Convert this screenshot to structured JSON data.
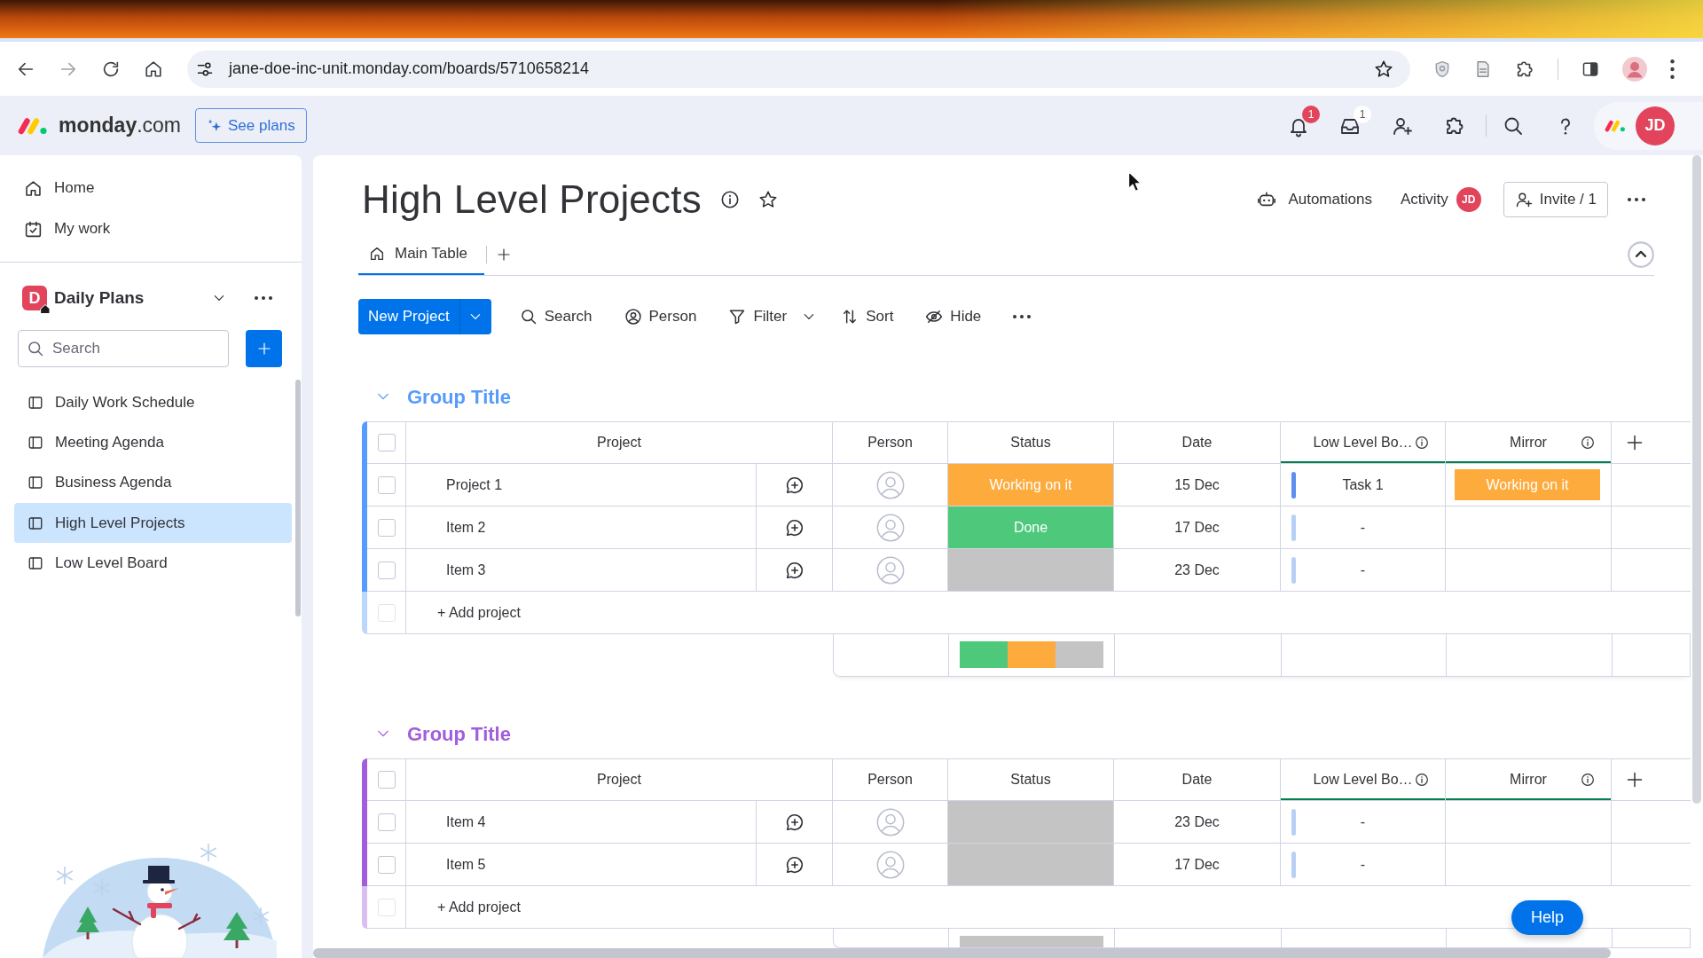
{
  "browser": {
    "url": "jane-doe-inc-unit.monday.com/boards/5710658214"
  },
  "app_header": {
    "logo": "**monday**.com",
    "see_plans": "See plans",
    "notifications": {
      "count": "1"
    },
    "inbox": {
      "count": "1"
    },
    "avatar": "JD"
  },
  "sidebar": {
    "nav": [
      {
        "label": "Home",
        "kind": "home"
      },
      {
        "label": "My work",
        "kind": "my_work"
      }
    ],
    "workspace": {
      "initial": "D",
      "name": "Daily Plans"
    },
    "search": {
      "placeholder": "Search"
    },
    "boards": [
      {
        "label": "Daily Work Schedule",
        "selected": false
      },
      {
        "label": "Meeting Agenda",
        "selected": false
      },
      {
        "label": "Business Agenda",
        "selected": false
      },
      {
        "label": "High Level Projects",
        "selected": true
      },
      {
        "label": "Low Level Board",
        "selected": false
      }
    ]
  },
  "board": {
    "title": "High Level Projects",
    "automations": "Automations",
    "activity": {
      "label": "Activity",
      "avatar": "JD"
    },
    "invite": "Invite / 1",
    "tabs": [
      {
        "label": "Main Table",
        "selected": true
      }
    ],
    "toolbar": {
      "primary": "New Project",
      "tools": [
        {
          "label": "Search",
          "kind": "search"
        },
        {
          "label": "Person",
          "kind": "person"
        },
        {
          "label": "Filter",
          "kind": "filter"
        },
        {
          "label": "Sort",
          "kind": "sort"
        },
        {
          "label": "Hide",
          "kind": "hide"
        }
      ]
    },
    "groups": [
      {
        "title": "Group Title",
        "color": "#579bfc",
        "select_all": {
          "checked": false
        },
        "columns": [
          {
            "label": "Project",
            "kind": "name"
          },
          {
            "label": "Person",
            "kind": "people"
          },
          {
            "label": "Status",
            "kind": "status"
          },
          {
            "label": "Date",
            "kind": "date"
          },
          {
            "label": "Low Level Bo…",
            "kind": "connect"
          },
          {
            "label": "Mirror",
            "kind": "mirror"
          }
        ],
        "rows": [
          {
            "name": "Project 1",
            "checked": false,
            "status": {
              "label": "Working on it",
              "color": "#fdab3d"
            },
            "date": "15 Dec",
            "link": {
              "label": "Task 1",
              "linked": true
            },
            "mirror": {
              "label": "Working on it",
              "color": "#fdab3d"
            }
          },
          {
            "name": "Item 2",
            "checked": false,
            "status": {
              "label": "Done",
              "color": "#4ec97b"
            },
            "date": "17 Dec",
            "link": {
              "label": "-",
              "linked": false
            }
          },
          {
            "name": "Item 3",
            "checked": false,
            "status": {
              "color": "#c4c4c4"
            },
            "date": "23 Dec",
            "link": {
              "label": "-",
              "linked": false
            }
          }
        ],
        "add_item": {
          "placeholder": "+ Add project",
          "checkbox": {
            "checked": false,
            "disabled": true
          }
        },
        "summary": [
          {
            "color": "#4ec97b"
          },
          {
            "color": "#fdab3d"
          },
          {
            "color": "#c4c4c4"
          }
        ]
      },
      {
        "title": "Group Title",
        "color": "#a25ddc",
        "select_all": {
          "checked": false
        },
        "columns": [
          {
            "label": "Project",
            "kind": "name"
          },
          {
            "label": "Person",
            "kind": "people"
          },
          {
            "label": "Status",
            "kind": "status"
          },
          {
            "label": "Date",
            "kind": "date"
          },
          {
            "label": "Low Level Bo…",
            "kind": "connect"
          },
          {
            "label": "Mirror",
            "kind": "mirror"
          }
        ],
        "rows": [
          {
            "name": "Item 4",
            "checked": false,
            "status": {
              "color": "#c4c4c4"
            },
            "date": "23 Dec",
            "link": {
              "label": "-",
              "linked": false
            }
          },
          {
            "name": "Item 5",
            "checked": false,
            "status": {
              "color": "#c4c4c4"
            },
            "date": "17 Dec",
            "link": {
              "label": "-",
              "linked": false
            }
          }
        ],
        "add_item": {
          "placeholder": "+ Add project",
          "checkbox": {
            "checked": false,
            "disabled": true
          }
        },
        "summary": [
          {
            "color": "#c4c4c4"
          }
        ]
      }
    ]
  },
  "help": {
    "label": "Help"
  }
}
